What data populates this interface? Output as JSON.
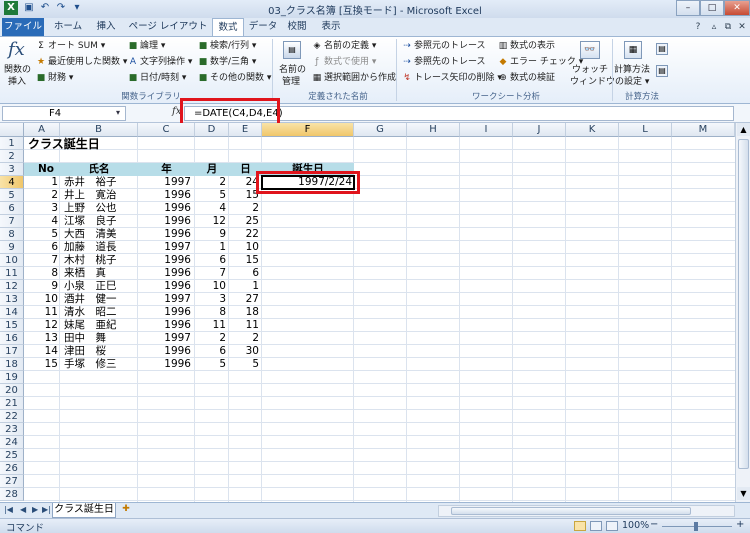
{
  "window": {
    "title": "03_クラス名簿 [互換モード] - Microsoft Excel",
    "quick_access": [
      "save-icon",
      "undo-icon",
      "redo-icon"
    ],
    "controls": {
      "minimize": "–",
      "maximize": "□",
      "close": "✕"
    }
  },
  "tabs": [
    "ファイル",
    "ホーム",
    "挿入",
    "ページ レイアウト",
    "数式",
    "データ",
    "校閲",
    "表示"
  ],
  "active_tab": "数式",
  "ribbon": {
    "insert_function": {
      "line1": "関数の",
      "line2": "挿入",
      "icon": "fx"
    },
    "function_library": {
      "items": [
        "オート SUM ▾",
        "最近使用した関数 ▾",
        "財務 ▾",
        "論理 ▾",
        "文字列操作 ▾",
        "日付/時刻 ▾",
        "検索/行列 ▾",
        "数学/三角 ▾",
        "その他の関数 ▾"
      ],
      "label": "関数ライブラリ"
    },
    "defined_names": {
      "manager_line1": "名前の",
      "manager_line2": "管理",
      "items": [
        "名前の定義 ▾",
        "数式で使用 ▾",
        "選択範囲から作成"
      ],
      "label": "定義された名前"
    },
    "formula_auditing": {
      "items": [
        "参照元のトレース",
        "参照先のトレース",
        "トレース矢印の削除 ▾",
        "数式の表示",
        "エラー チェック ▾",
        "数式の検証"
      ],
      "watch_line1": "ウォッチ",
      "watch_line2": "ウィンドウ",
      "label": "ワークシート分析"
    },
    "calculation": {
      "line1": "計算方法",
      "line2": "の設定 ▾",
      "label": "計算方法"
    }
  },
  "formula_bar": {
    "name_box": "F4",
    "fx": "fx",
    "formula": "=DATE(C4,D4,E4)"
  },
  "columns": [
    "A",
    "B",
    "C",
    "D",
    "E",
    "F",
    "G",
    "H",
    "I",
    "J",
    "K",
    "L",
    "M"
  ],
  "selected_column": "F",
  "row_numbers": [
    "1",
    "2",
    "3",
    "4",
    "5",
    "6",
    "7",
    "8",
    "9",
    "10",
    "11",
    "12",
    "13",
    "14",
    "15",
    "16",
    "17",
    "18",
    "19",
    "20",
    "21",
    "22",
    "23",
    "24",
    "25",
    "26",
    "27",
    "28"
  ],
  "selected_row": "4",
  "sheet": {
    "title": "クラス誕生日",
    "headers": {
      "no": "No",
      "name": "氏名",
      "year": "年",
      "month": "月",
      "day": "日",
      "birthday": "誕生日"
    },
    "rows": [
      [
        "1",
        "赤井　裕子",
        "1997",
        "2",
        "24"
      ],
      [
        "2",
        "井上　寛治",
        "1996",
        "5",
        "15"
      ],
      [
        "3",
        "上野　公也",
        "1996",
        "4",
        "2"
      ],
      [
        "4",
        "江塚　良子",
        "1996",
        "12",
        "25"
      ],
      [
        "5",
        "大西　清美",
        "1996",
        "9",
        "22"
      ],
      [
        "6",
        "加藤　道長",
        "1997",
        "1",
        "10"
      ],
      [
        "7",
        "木村　桃子",
        "1996",
        "6",
        "15"
      ],
      [
        "8",
        "来栖　真",
        "1996",
        "7",
        "6"
      ],
      [
        "9",
        "小泉　正巳",
        "1996",
        "10",
        "1"
      ],
      [
        "10",
        "酒井　健一",
        "1997",
        "3",
        "27"
      ],
      [
        "11",
        "清水　昭二",
        "1996",
        "8",
        "18"
      ],
      [
        "12",
        "妹尾　亜紀",
        "1996",
        "11",
        "11"
      ],
      [
        "13",
        "田中　舞",
        "1997",
        "2",
        "2"
      ],
      [
        "14",
        "津田　桜",
        "1996",
        "6",
        "30"
      ],
      [
        "15",
        "手塚　修三",
        "1996",
        "5",
        "5"
      ]
    ],
    "f4_value": "1997/2/24"
  },
  "sheet_tabs": {
    "nav": [
      "|◀",
      "◀",
      "▶",
      "▶|"
    ],
    "active": "クラス誕生日",
    "new_sheet_icon": "new-sheet-icon"
  },
  "status": {
    "mode": "コマンド",
    "zoom": "100%",
    "zoom_out": "−",
    "zoom_in": "+"
  },
  "colors": {
    "header_fill": "#b7dde8",
    "highlight": "#e0141c",
    "file_tab": "#2a6bb8"
  }
}
